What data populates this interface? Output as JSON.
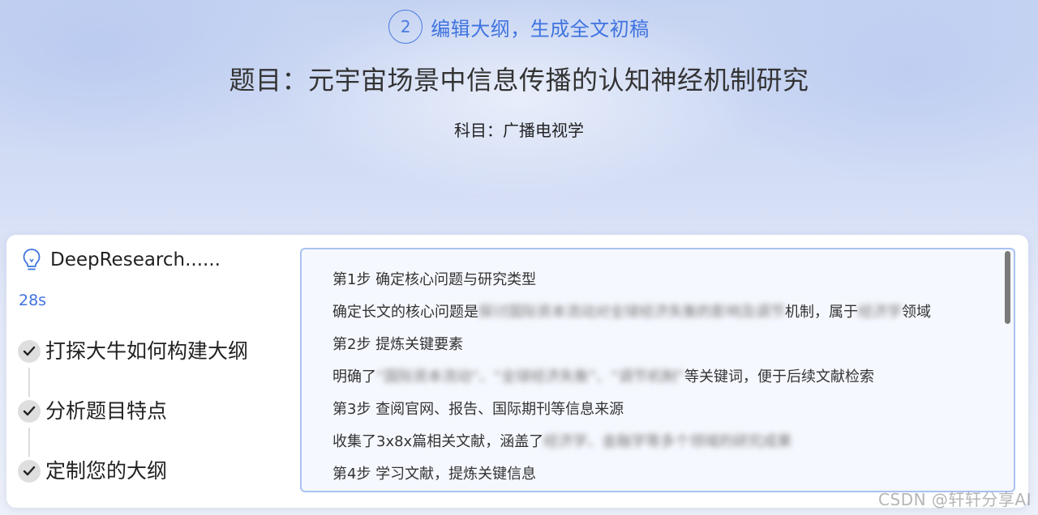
{
  "header": {
    "step_number": "2",
    "step_title": "编辑大纲，生成全文初稿",
    "page_title": "题目：元宇宙场景中信息传播的认知神经机制研究",
    "subject": "科目：广播电视学"
  },
  "panel": {
    "research_title": "DeepResearch......",
    "timer": "28s",
    "steps": [
      {
        "label": "打探大牛如何构建大纲"
      },
      {
        "label": "分析题目特点"
      },
      {
        "label": "定制您的大纲"
      }
    ],
    "lines": [
      {
        "text": "第1步 确定核心问题与研究类型"
      },
      {
        "pre": "确定长文的核心问题是",
        "blur1": "探讨国际资本流动对全球经济失衡的影响及调节",
        "mid": "机制，属于",
        "blur2": "经济学",
        "post": "领域"
      },
      {
        "text": "第2步 提炼关键要素"
      },
      {
        "pre": "明确了",
        "blur1": "“国际资本流动”、“全球经济失衡”、“调节机制”",
        "mid": "等关键词，便于后续文献检索"
      },
      {
        "text": "第3步 查阅官网、报告、国际期刊等信息来源"
      },
      {
        "pre": "收集了3x8x篇相关文献，涵盖了",
        "blur1": "经济学、金融学等多个领域的研究成果"
      },
      {
        "text": "第4步 学习文献，提炼关键信息"
      }
    ]
  },
  "watermark": "CSDN @轩轩分享AI",
  "colors": {
    "accent": "#3f73e0",
    "box_border": "#a9c2f1",
    "box_bg": "#f5f8fe"
  },
  "icons": [
    "lightbulb-icon",
    "check-icon"
  ]
}
